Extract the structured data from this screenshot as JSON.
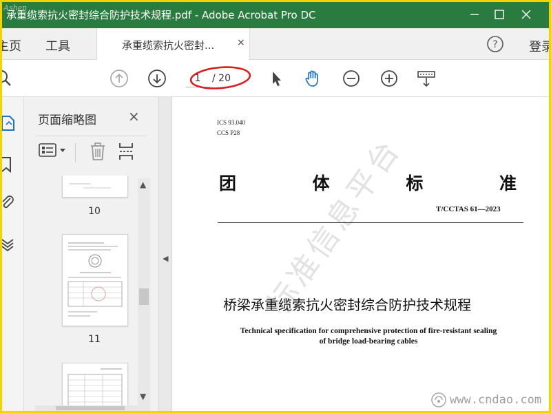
{
  "window": {
    "title": "承重缆索抗火密封综合防护技术规程.pdf - Adobe Acrobat Pro DC",
    "corner_watermark": "Ashen"
  },
  "menu": {
    "home": "主页",
    "tools": "工具",
    "doc_tab": "承重缆索抗火密封...",
    "doc_tab_close": "×",
    "login": "登录"
  },
  "toolbar": {
    "page_current": "1",
    "page_total": "/ 20"
  },
  "thumbnails": {
    "title": "页面缩略图",
    "close": "×",
    "items": [
      {
        "label": "10"
      },
      {
        "label": "11"
      }
    ]
  },
  "document": {
    "ics": "ICS 93.040",
    "ccs": "CCS P28",
    "heading_chars": [
      "团",
      "体",
      "标",
      "准"
    ],
    "number": "T/CCTAS 61—2023",
    "title_zh": "桥梁承重缆索抗火密封综合防护技术规程",
    "title_en_line1": "Technical specification for comprehensive protection of fire-resistant sealing",
    "title_en_line2": "of bridge load-bearing cables"
  },
  "watermarks": {
    "diagonal": "标准信息平台",
    "site": "www.cndao.com"
  },
  "colors": {
    "titlebar": "#2a7b3f",
    "frame": "#f3d400",
    "highlight_ellipse": "#d62020",
    "hand_tool": "#1f6fc5"
  }
}
